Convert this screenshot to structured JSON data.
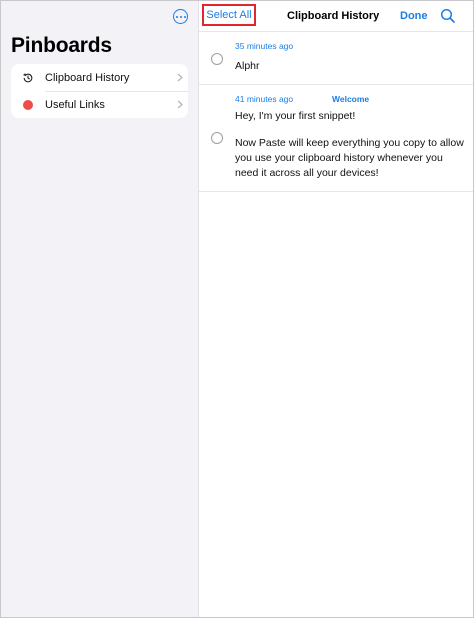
{
  "sidebar": {
    "title": "Pinboards",
    "more_icon": "ellipsis-circle-icon",
    "items": [
      {
        "label": "Clipboard History",
        "icon": "history-icon"
      },
      {
        "label": "Useful Links",
        "icon": "red-dot-icon",
        "color": "#ee4b4b"
      }
    ]
  },
  "toolbar": {
    "select_all_label": "Select All",
    "title": "Clipboard History",
    "done_label": "Done",
    "search_icon": "search-icon"
  },
  "clips": [
    {
      "time": "35 minutes ago",
      "tag": "",
      "lines": [
        "Alphr"
      ]
    },
    {
      "time": "41 minutes ago",
      "tag": "Welcome",
      "lines": [
        "Hey, I'm your first snippet!",
        "Now Paste will keep everything you copy to allow you use your clipboard history whenever you need it across all your devices!"
      ]
    }
  ],
  "colors": {
    "accent": "#1a7ee6",
    "highlight": "#e0262e",
    "sidebar_bg": "#f2f2f7"
  }
}
